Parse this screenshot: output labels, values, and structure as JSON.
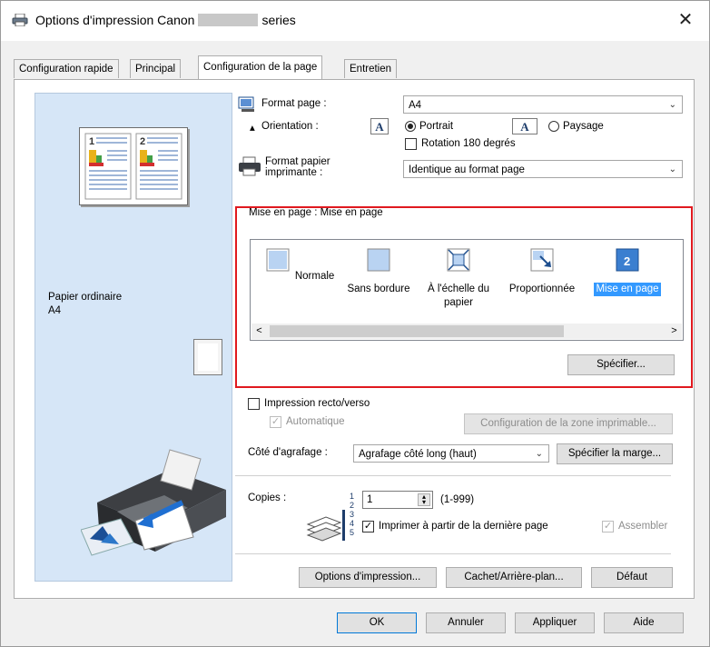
{
  "window": {
    "title_prefix": "Options d'impression Canon",
    "title_suffix": "series",
    "close": "✕"
  },
  "tabs": [
    {
      "label": "Configuration rapide"
    },
    {
      "label": "Principal"
    },
    {
      "label": "Configuration de la page"
    },
    {
      "label": "Entretien"
    }
  ],
  "preview": {
    "paper_type": "Papier ordinaire",
    "paper_size": "A4"
  },
  "page_setup": {
    "page_size_label": "Format page :",
    "page_size_value": "A4",
    "orientation_label": "Orientation :",
    "portrait": "Portrait",
    "landscape": "Paysage",
    "rotate180": "Rotation 180 degrés",
    "printer_paper_label_1": "Format papier",
    "printer_paper_label_2": "imprimante :",
    "printer_paper_value": "Identique au format page",
    "layout_label": "Mise en page :  Mise en page",
    "layouts": [
      {
        "label": "Normale"
      },
      {
        "label": "Sans bordure"
      },
      {
        "label": "À l'échelle du",
        "label2": "papier"
      },
      {
        "label": "Proportionnée"
      },
      {
        "label": "Mise en page"
      }
    ],
    "specify": "Spécifier...",
    "duplex": "Impression recto/verso",
    "automatic": "Automatique",
    "print_area": "Configuration de la zone imprimable...",
    "stapling_label": "Côté d'agrafage :",
    "stapling_value": "Agrafage côté long (haut)",
    "margin": "Spécifier la marge...",
    "copies_label": "Copies :",
    "copies_value": "1",
    "copies_range": "(1-999)",
    "last_page": "Imprimer à partir de la dernière page",
    "collate": "Assembler",
    "print_options": "Options d'impression...",
    "stamp": "Cachet/Arrière-plan...",
    "defaults": "Défaut"
  },
  "footer": {
    "ok": "OK",
    "cancel": "Annuler",
    "apply": "Appliquer",
    "help": "Aide"
  },
  "colors": {
    "accent": "#3399ff",
    "highlight_frame": "#e0191f",
    "preview_bg": "#d6e6f7"
  }
}
